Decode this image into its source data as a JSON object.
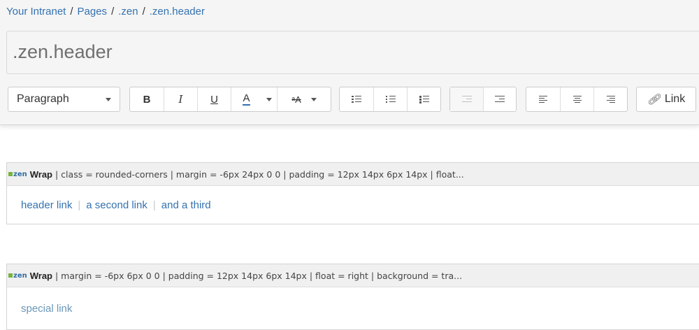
{
  "breadcrumb": {
    "items": [
      "Your Intranet",
      "Pages",
      ".zen",
      ".zen.header"
    ],
    "separator": "/"
  },
  "page": {
    "title": ".zen.header"
  },
  "toolbar": {
    "paragraph_label": "Paragraph",
    "bold_label": "B",
    "italic_label": "I",
    "underline_label": "U",
    "text_color_label": "A",
    "text_color_accent": "#3572b0",
    "format_label": "ᵃA",
    "link_label": "Link",
    "icons": {
      "bullet_list": "bullet-list-icon",
      "numbered_list": "numbered-list-icon",
      "task_list": "task-list-icon",
      "outdent": "outdent-icon",
      "indent": "indent-icon",
      "align_left": "align-left-icon",
      "align_center": "align-center-icon",
      "align_right": "align-right-icon",
      "link": "link-icon"
    }
  },
  "macros": [
    {
      "icon": "zen",
      "name": "Wrap",
      "params": "| class = rounded-corners | margin = -6px 24px 0 0 | padding = 12px 14px 6px 14px | float...",
      "links": [
        "header link",
        "a second link",
        "and a third"
      ]
    },
    {
      "icon": "zen",
      "name": "Wrap",
      "params": "| margin = -6px 6px 0 0 | padding = 12px 14px 6px 14px | float = right | background = tra...",
      "links": [
        "special link"
      ]
    }
  ],
  "colors": {
    "link": "#3572b0",
    "special_link": "#6b97b8",
    "zen_icon_green": "#78b43c"
  }
}
